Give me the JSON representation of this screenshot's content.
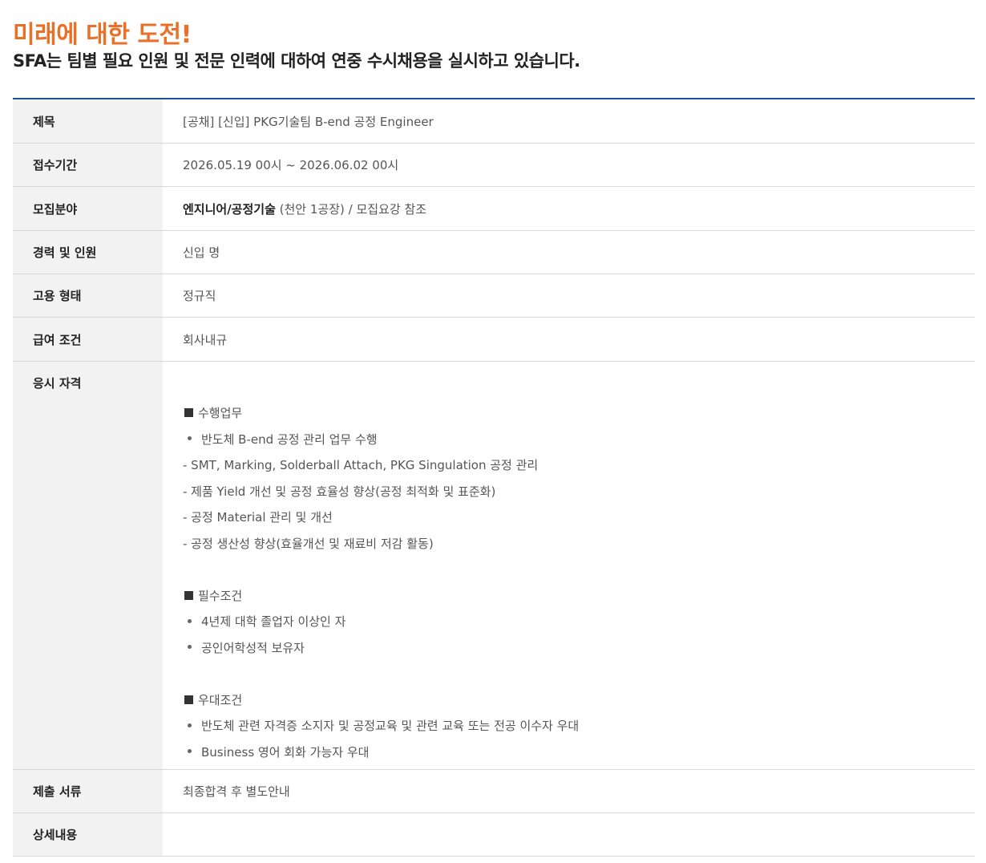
{
  "header": {
    "title": "미래에 대한 도전!",
    "subtitle": "SFA는 팀별 필요 인원 및 전문 인력에 대하여 연중 수시채용을 실시하고 있습니다."
  },
  "rows": {
    "title": {
      "label": "제목",
      "value": "[공채] [신입] PKG기술팀 B-end 공정 Engineer"
    },
    "period": {
      "label": "접수기간",
      "value": "2026.05.19 00시 ~ 2026.06.02 00시"
    },
    "field": {
      "label": "모집분야",
      "value_bold": "엔지니어/공정기술",
      "value_rest": " (천안 1공장) / 모집요강 참조"
    },
    "career": {
      "label": "경력 및 인원",
      "value": "신입 명"
    },
    "employment": {
      "label": "고용 형태",
      "value": "정규직"
    },
    "salary": {
      "label": "급여 조건",
      "value": "회사내규"
    },
    "qualification": {
      "label": "응시 자격",
      "duties": {
        "heading": "수행업무",
        "bullets": [
          "반도체 B-end 공정 관리 업무 수행"
        ],
        "dashes": [
          "- SMT, Marking, Solderball Attach, PKG Singulation 공정 관리",
          "- 제품 Yield 개선 및 공정 효율성 향상(공정 최적화 및 표준화)",
          "- 공정 Material 관리 및 개선",
          "- 공정 생산성 향상(효율개선 및 재료비 저감 활동)"
        ]
      },
      "required": {
        "heading": "필수조건",
        "bullets": [
          "4년제 대학 졸업자 이상인 자",
          "공인어학성적 보유자"
        ]
      },
      "preferred": {
        "heading": "우대조건",
        "bullets": [
          "반도체 관련 자격증 소지자 및 공정교육 및 관련 교육 또는 전공 이수자 우대",
          "Business 영어 회화 가능자 우대"
        ]
      }
    },
    "documents": {
      "label": "제출 서류",
      "value": "최종합격 후 별도안내"
    },
    "details": {
      "label": "상세내용",
      "value": ""
    }
  }
}
